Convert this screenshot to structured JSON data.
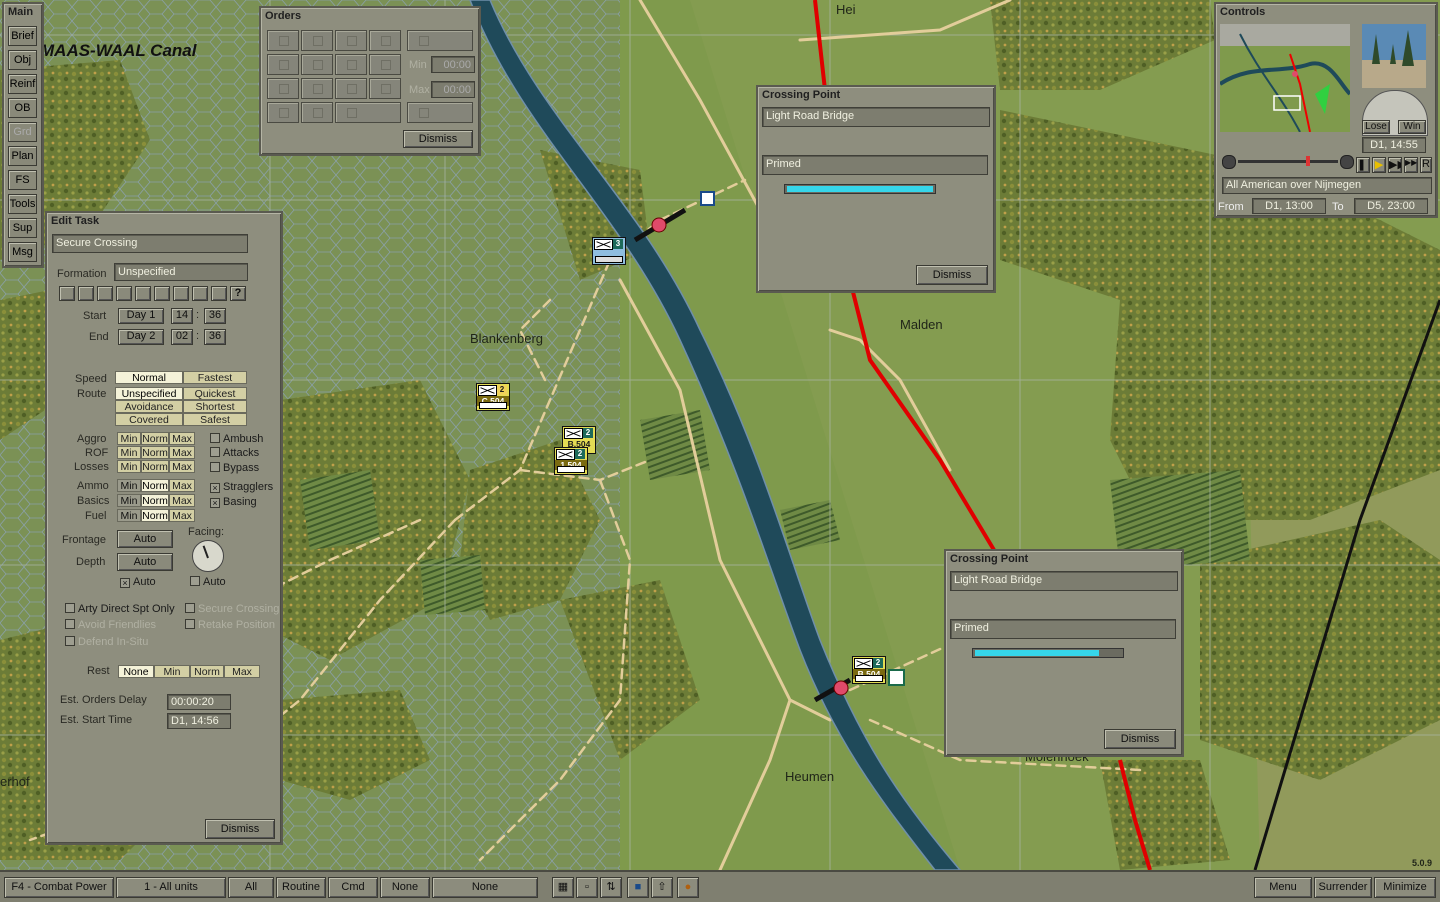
{
  "map": {
    "canal_label": "MAAS-WAAL Canal",
    "towns": {
      "hei": "Hei",
      "blankenberg": "Blankenberg",
      "malden": "Malden",
      "heumen": "Heumen",
      "molenhoek": "Molenhoek",
      "erhof": "erhof"
    },
    "units": [
      {
        "label": "3",
        "name": ""
      },
      {
        "label": "2",
        "name": "C.504"
      },
      {
        "label": "2",
        "name": "B.504"
      },
      {
        "label": "2",
        "name": "1.504"
      },
      {
        "label": "2",
        "name": "B.504"
      }
    ],
    "version": "5.0.9"
  },
  "sidebar": {
    "title": "Main",
    "items": [
      "Brief",
      "Obj",
      "Reinf",
      "OB",
      "Grd",
      "Plan",
      "FS",
      "Tools",
      "Sup",
      "Msg"
    ]
  },
  "orders": {
    "title": "Orders",
    "min_label": "Min",
    "max_label": "Max",
    "min_value": "00:00",
    "max_value": "00:00",
    "dismiss": "Dismiss"
  },
  "crossing1": {
    "title": "Crossing Point",
    "type": "Light Road Bridge",
    "status": "Primed",
    "dismiss": "Dismiss"
  },
  "crossing2": {
    "title": "Crossing Point",
    "type": "Light Road Bridge",
    "status": "Primed",
    "dismiss": "Dismiss"
  },
  "controls": {
    "title": "Controls",
    "lose": "Lose",
    "win": "Win",
    "current_time": "D1, 14:55",
    "scenario": "All American over Nijmegen",
    "from_label": "From",
    "from_value": "D1, 13:00",
    "to_label": "To",
    "to_value": "D5, 23:00",
    "replay_btn": "R"
  },
  "edit_task": {
    "title": "Edit Task",
    "task": "Secure Crossing",
    "formation_label": "Formation",
    "formation_value": "Unspecified",
    "formation_help": "?",
    "start_label": "Start",
    "start_day": "Day 1",
    "start_h": "14",
    "start_m": "36",
    "end_label": "End",
    "end_day": "Day 2",
    "end_h": "02",
    "end_m": "36",
    "colon": ":",
    "speed_label": "Speed",
    "speed_opts": [
      "Normal",
      "Fastest"
    ],
    "route_label": "Route",
    "route_opts": [
      "Unspecified",
      "Quickest",
      "Avoidance",
      "Shortest",
      "Covered",
      "Safest"
    ],
    "aggro_label": "Aggro",
    "rof_label": "ROF",
    "losses_label": "Losses",
    "ammo_label": "Ammo",
    "basics_label": "Basics",
    "fuel_label": "Fuel",
    "level_opts": [
      "Min",
      "Norm",
      "Max"
    ],
    "ambush": "Ambush",
    "attacks": "Attacks",
    "bypass": "Bypass",
    "stragglers": "Stragglers",
    "basing": "Basing",
    "frontage_label": "Frontage",
    "frontage_value": "Auto",
    "depth_label": "Depth",
    "depth_value": "Auto",
    "facing_label": "Facing:",
    "auto1": "Auto",
    "auto2": "Auto",
    "arty": "Arty Direct Spt Only",
    "secure_crossing": "Secure Crossing",
    "avoid_friendlies": "Avoid Friendlies",
    "retake_position": "Retake Position",
    "defend_in_situ": "Defend In-Situ",
    "rest_label": "Rest",
    "rest_opts": [
      "None",
      "Min",
      "Norm",
      "Max"
    ],
    "orders_delay_label": "Est. Orders Delay",
    "orders_delay_value": "00:00:20",
    "start_time_label": "Est. Start Time",
    "start_time_value": "D1, 14:56",
    "dismiss": "Dismiss"
  },
  "bottombar": {
    "combat_power": "F4 - Combat Power",
    "all_units": "1 - All units",
    "all": "All",
    "routine": "Routine",
    "cmd": "Cmd",
    "none1": "None",
    "none2": "None",
    "menu": "Menu",
    "surrender": "Surrender",
    "minimize": "Minimize"
  },
  "colors": {
    "river": "#1f4a5a",
    "road": "#e2cd9a",
    "rail": "#e00000",
    "panel": "#8e8e7e",
    "field": "#7f9a4c",
    "forest": "#6b7a35"
  }
}
